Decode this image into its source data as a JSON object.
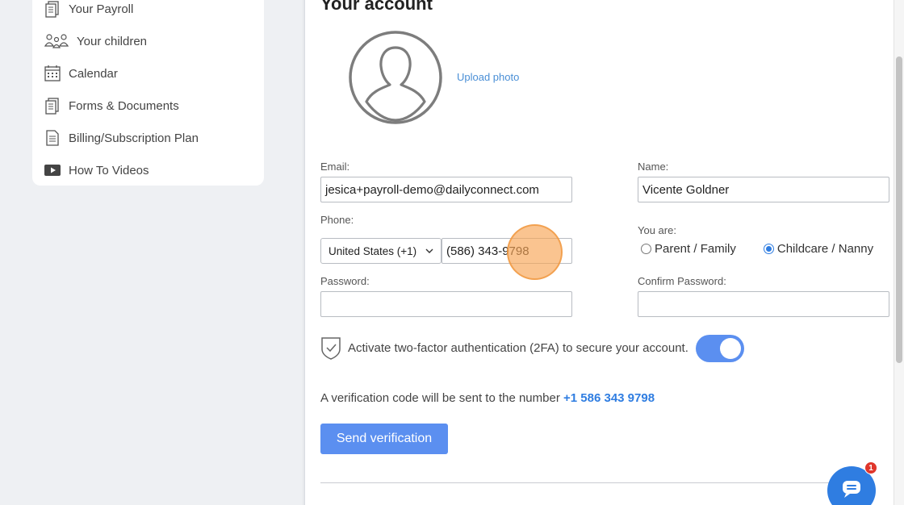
{
  "sidebar": {
    "items": [
      {
        "label": "Your Payroll",
        "icon": "payroll-icon"
      },
      {
        "label": "Your children",
        "icon": "children-icon"
      },
      {
        "label": "Calendar",
        "icon": "calendar-icon"
      },
      {
        "label": "Forms & Documents",
        "icon": "forms-icon"
      },
      {
        "label": "Billing/Subscription Plan",
        "icon": "billing-icon"
      },
      {
        "label": "How To Videos",
        "icon": "video-icon"
      }
    ]
  },
  "account": {
    "title": "Your account",
    "upload_label": "Upload photo",
    "email_label": "Email:",
    "email_value": "jesica+payroll-demo@dailyconnect.com",
    "name_label": "Name:",
    "name_value": "Vicente Goldner",
    "phone_label": "Phone:",
    "country_value": "United States (+1)",
    "phone_value": "(586) 343-9798",
    "you_are_label": "You are:",
    "role_options": [
      {
        "label": "Parent / Family",
        "selected": false
      },
      {
        "label": "Childcare / Nanny",
        "selected": true
      }
    ],
    "password_label": "Password:",
    "password_value": "",
    "confirm_password_label": "Confirm Password:",
    "confirm_password_value": "",
    "tfa_text": "Activate two-factor authentication (2FA) to secure your account.",
    "tfa_enabled": true,
    "verify_text": "A verification code will be sent to the number",
    "verify_number": "+1 586 343 9798",
    "send_button": "Send verification"
  },
  "chat": {
    "badge_count": "1",
    "icon": "chat-icon"
  },
  "colors": {
    "accent": "#5b8ff0",
    "link": "#2f7de1",
    "badge": "#e0362b",
    "highlight": "#f8a555"
  }
}
